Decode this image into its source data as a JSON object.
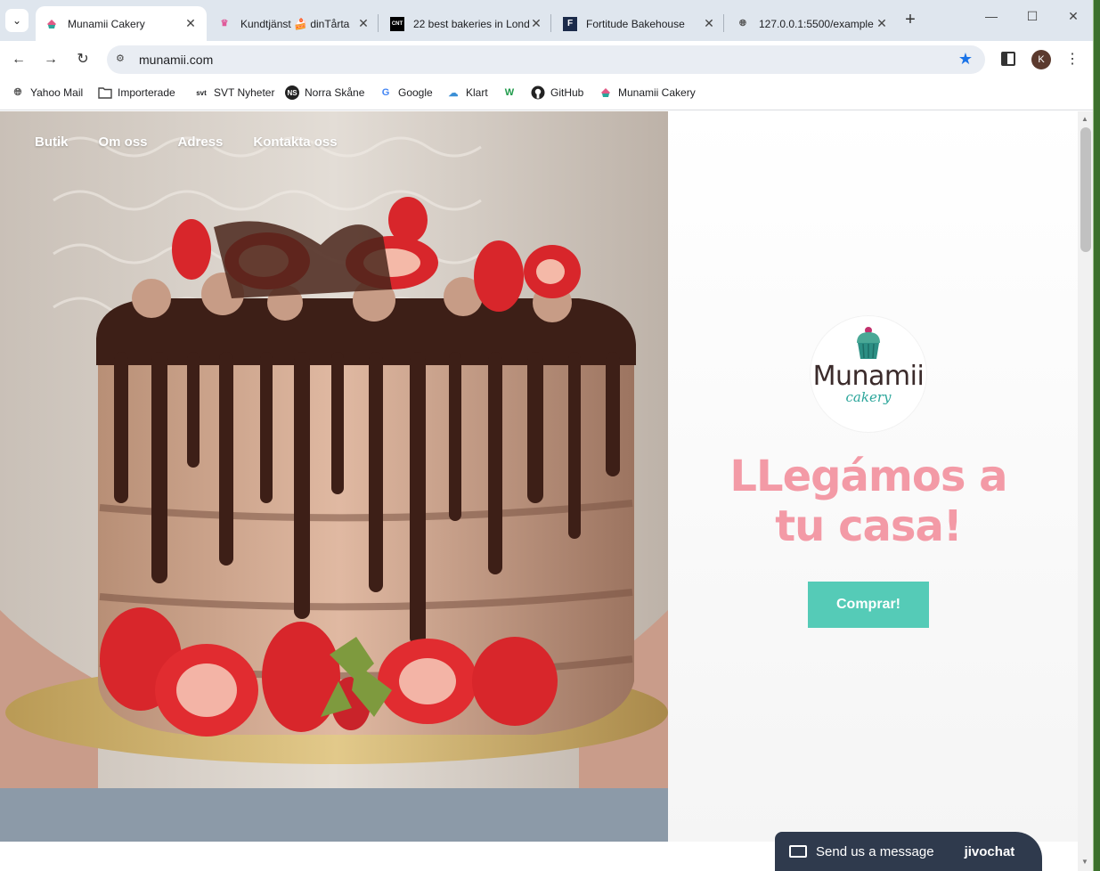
{
  "browser": {
    "tabs": [
      {
        "title": "Munamii Cakery",
        "active": true,
        "favicon": "munamii-favicon"
      },
      {
        "title": "Kundtjänst 🍰 dinTårta",
        "active": false,
        "favicon": "crown-favicon"
      },
      {
        "title": "22 best bakeries in London",
        "active": false,
        "favicon": "cnt-favicon"
      },
      {
        "title": "Fortitude Bakehouse",
        "active": false,
        "favicon": "f-favicon"
      },
      {
        "title": "127.0.0.1:5500/example",
        "active": false,
        "favicon": "globe-favicon"
      }
    ],
    "url": "munamii.com",
    "profile_initial": "K",
    "bookmarks": [
      {
        "label": "Yahoo Mail",
        "icon": "globe-icon"
      },
      {
        "label": "Importerade",
        "icon": "folder-icon"
      },
      {
        "label": "SVT Nyheter",
        "icon": "svt-icon"
      },
      {
        "label": "Norra Skåne",
        "icon": "ns-icon"
      },
      {
        "label": "Google",
        "icon": "google-icon"
      },
      {
        "label": "Klart",
        "icon": "cloud-icon"
      },
      {
        "label": "",
        "icon": "w-icon"
      },
      {
        "label": "GitHub",
        "icon": "github-icon"
      },
      {
        "label": "Munamii Cakery",
        "icon": "munamii-icon"
      }
    ]
  },
  "site": {
    "nav": [
      "Butik",
      "Om oss",
      "Adress",
      "Kontakta oss"
    ],
    "logo": {
      "brand": "Munamii",
      "sub": "cakery"
    },
    "headline": "LLegámos a tu casa!",
    "cta": "Comprar!"
  },
  "chat": {
    "message": "Send us a message",
    "brand": "jivochat"
  },
  "colors": {
    "accent": "#55cbb7",
    "headline": "#f39aa6",
    "chat_bg": "#2f3a4d"
  }
}
